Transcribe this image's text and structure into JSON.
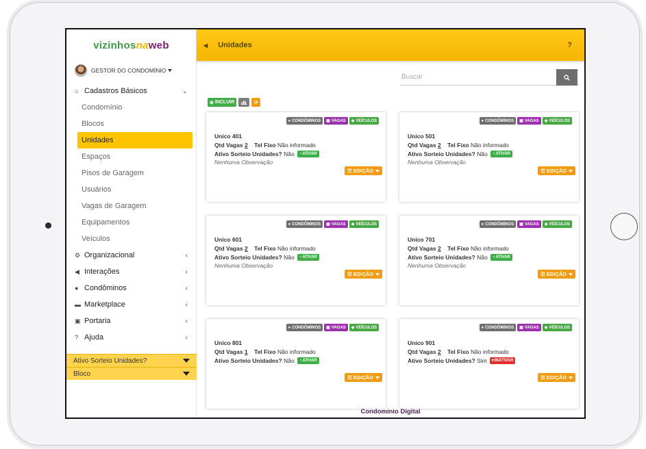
{
  "app": {
    "logo_part1": "vizinhos",
    "logo_part2": "na",
    "logo_part3": "web",
    "user_role": "GESTOR DO CONDOMÍNIO",
    "footer": "Condomínio Digital"
  },
  "sidebar": {
    "cadastros_label": "Cadastros Básicos",
    "cadastros_items": [
      "Condomínio",
      "Blocos",
      "Unidades",
      "Espaços",
      "Pisos de Garagem",
      "Usuários",
      "Vagas de Garagem",
      "Equipamentos",
      "Veículos"
    ],
    "active_item": "Unidades",
    "groups": [
      {
        "label": "Organizacional",
        "icon": "cogs-icon"
      },
      {
        "label": "Interações",
        "icon": "bullhorn-icon"
      },
      {
        "label": "Condôminos",
        "icon": "users-icon"
      },
      {
        "label": "Marketplace",
        "icon": "cart-icon"
      },
      {
        "label": "Portaria",
        "icon": "building-icon"
      },
      {
        "label": "Ajuda",
        "icon": "question-icon"
      }
    ],
    "filters": [
      "Ativo Sorteio Unidades?",
      "Bloco"
    ]
  },
  "header": {
    "title": "Unidades",
    "help": "?"
  },
  "search": {
    "placeholder": "Buscar"
  },
  "toolbar": {
    "include_label": "INCLUIR"
  },
  "card_labels": {
    "badge_condominos": "CONDÔMINOS",
    "badge_vagas": "VAGAS",
    "badge_veiculos": "VEÍCULOS",
    "qtd_vagas": "Qtd Vagas",
    "tel_fixo": "Tel Fixo",
    "ativo_sorteio": "Ativo Sorteio Unidades?",
    "edit": "EDIÇÃO"
  },
  "units": [
    {
      "name": "Unico 401",
      "vagas": "2",
      "tel": "Não informado",
      "sorteio": "Não",
      "status": "ATIVAR",
      "obs": "Nenhuma Observação"
    },
    {
      "name": "Unico 501",
      "vagas": "2",
      "tel": "Não informado",
      "sorteio": "Não",
      "status": "ATIVAR",
      "obs": "Nenhuma Observação"
    },
    {
      "name": "Unico 601",
      "vagas": "2",
      "tel": "Não informado",
      "sorteio": "Não",
      "status": "ATIVAR",
      "obs": "Nenhuma Observação"
    },
    {
      "name": "Unico 701",
      "vagas": "2",
      "tel": "Não informado",
      "sorteio": "Não",
      "status": "ATIVAR",
      "obs": "Nenhuma Observação"
    },
    {
      "name": "Unico 801",
      "vagas": "1",
      "tel": "Não informado",
      "sorteio": "Não",
      "status": "ATIVAR",
      "obs": ""
    },
    {
      "name": "Unico 901",
      "vagas": "2",
      "tel": "Não informado",
      "sorteio": "Sim",
      "status": "INATIVAR",
      "obs": ""
    }
  ],
  "colors": {
    "accent": "#ffc400",
    "green": "#3fae49",
    "purple": "#9b2fae",
    "orange": "#f39c12",
    "red": "#e53030"
  }
}
